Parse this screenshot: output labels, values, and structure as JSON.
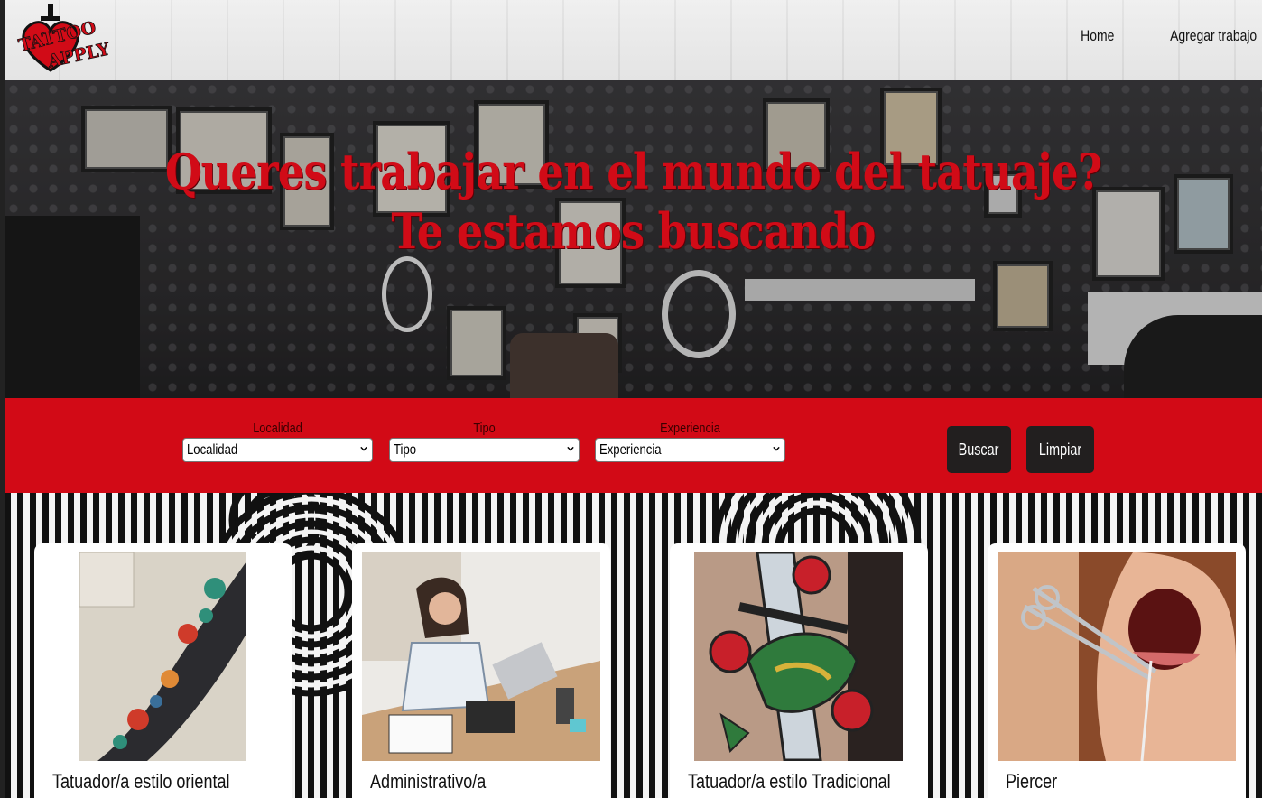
{
  "navbar": {
    "logo_text_top": "TATTOO",
    "logo_text_bottom": "APPLY",
    "links": [
      {
        "label": "Home"
      },
      {
        "label": "Agregar trabajo"
      }
    ]
  },
  "hero": {
    "line1": "Queres trabajar en el mundo del tatuaje?",
    "line2": "Te estamos buscando"
  },
  "filters": {
    "localidad": {
      "label": "Localidad",
      "value": "Localidad"
    },
    "tipo": {
      "label": "Tipo",
      "value": "Tipo"
    },
    "experiencia": {
      "label": "Experiencia",
      "value": "Experiencia"
    },
    "search_label": "Buscar",
    "clear_label": "Limpiar"
  },
  "cards": [
    {
      "title": "Tatuador/a estilo oriental"
    },
    {
      "title": "Administrativo/a"
    },
    {
      "title": "Tatuador/a estilo Tradicional"
    },
    {
      "title": "Piercer"
    }
  ],
  "colors": {
    "brand_red": "#d20a16",
    "button_dark": "#221f1f"
  }
}
